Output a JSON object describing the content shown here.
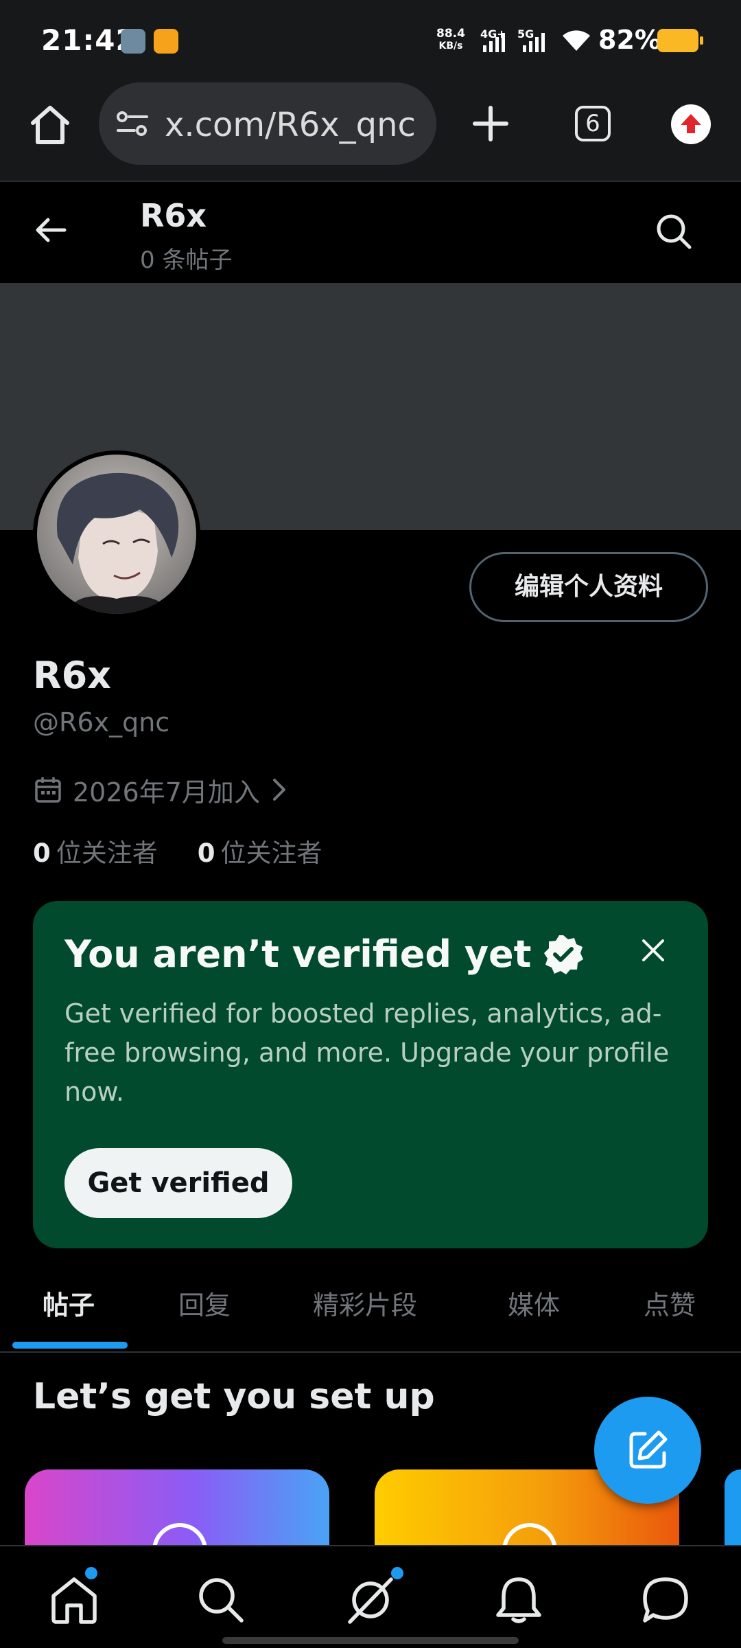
{
  "status_bar": {
    "time": "21:42",
    "net_speed_value": "88.4",
    "net_speed_unit": "KB/s",
    "sim1_label": "4G+",
    "sim2_label": "5G",
    "battery_pct": "82%",
    "battery_color": "#f9b824"
  },
  "browser": {
    "url": "x.com/R6x_qnc",
    "tab_count": "6"
  },
  "header": {
    "name": "R6x",
    "post_count": "0 条帖子"
  },
  "profile": {
    "edit_button": "编辑个人资料",
    "display_name": "R6x",
    "handle": "@R6x_qnc",
    "joined": "2026年7月加入",
    "following_count": "0",
    "following_label": "位关注者",
    "followers_count": "0",
    "followers_label": "位关注者"
  },
  "verify_card": {
    "title": "You aren’t verified yet",
    "body": "Get verified for boosted replies, analytics, ad-free browsing, and more. Upgrade your profile now.",
    "button": "Get verified",
    "bg_color": "#014a2d"
  },
  "tabs": [
    {
      "label": "帖子",
      "active": true
    },
    {
      "label": "回复",
      "active": false
    },
    {
      "label": "精彩片段",
      "active": false
    },
    {
      "label": "媒体",
      "active": false
    },
    {
      "label": "点赞",
      "active": false
    }
  ],
  "setup": {
    "title": "Let’s get you set up"
  },
  "colors": {
    "accent": "#1d9bf0",
    "banner": "#333639"
  },
  "icons": [
    "home-icon",
    "site-settings-icon",
    "plus-icon",
    "tabs-icon",
    "update-icon",
    "back-arrow-icon",
    "search-icon",
    "calendar-icon",
    "chevron-right-icon",
    "verified-badge-icon",
    "close-icon",
    "compose-icon",
    "home-nav-icon",
    "search-nav-icon",
    "grok-icon",
    "notifications-icon",
    "messages-icon"
  ]
}
